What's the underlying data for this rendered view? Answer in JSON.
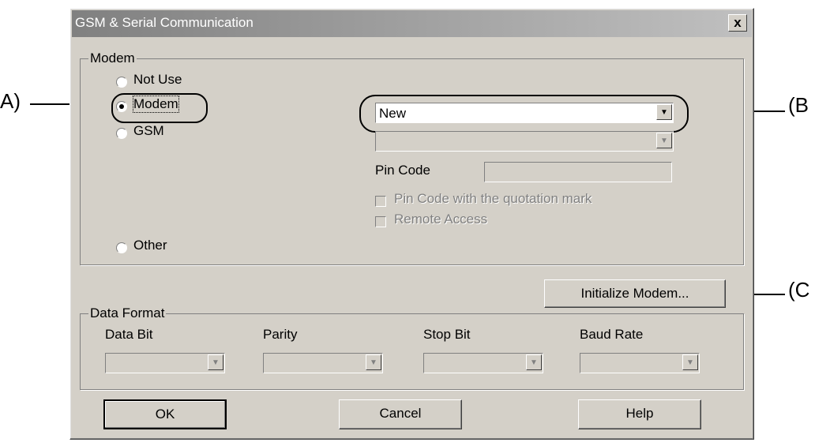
{
  "window": {
    "title": "GSM & Serial Communication",
    "close_label": "x"
  },
  "modem_group": {
    "title": "Modem",
    "radios": [
      {
        "label": "Not Use",
        "checked": false
      },
      {
        "label": "Modem",
        "checked": true
      },
      {
        "label": "GSM",
        "checked": false
      },
      {
        "label": "Other",
        "checked": false
      }
    ],
    "modem_select": {
      "value": "New"
    },
    "second_select": {
      "value": ""
    },
    "pin_code_label": "Pin Code",
    "pin_code_value": "",
    "pin_quotation_label": "Pin Code with the quotation mark",
    "remote_access_label": "Remote Access",
    "initialize_button": "Initialize Modem..."
  },
  "data_format_group": {
    "title": "Data Format",
    "fields": [
      {
        "label": "Data Bit",
        "value": ""
      },
      {
        "label": "Parity",
        "value": ""
      },
      {
        "label": "Stop Bit",
        "value": ""
      },
      {
        "label": "Baud Rate",
        "value": ""
      }
    ]
  },
  "buttons": {
    "ok": "OK",
    "cancel": "Cancel",
    "help": "Help"
  },
  "annotations": {
    "a": "A)",
    "b": "(B",
    "c": "(C"
  }
}
